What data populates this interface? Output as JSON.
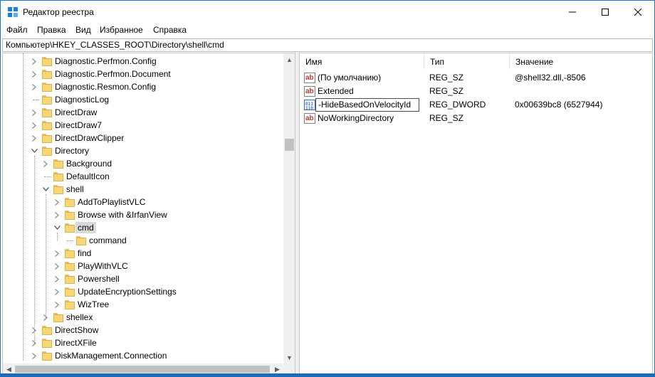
{
  "window": {
    "title": "Редактор реестра",
    "controls": {
      "minimize": "—",
      "maximize": "☐",
      "close": "✕"
    }
  },
  "menu": [
    "Файл",
    "Правка",
    "Вид",
    "Избранное",
    "Справка"
  ],
  "address": "Компьютер\\HKEY_CLASSES_ROOT\\Directory\\shell\\cmd",
  "tree": {
    "items": [
      {
        "label": "Diagnostic.Perfmon.Config",
        "level": 0,
        "expander": "closed"
      },
      {
        "label": "Diagnostic.Perfmon.Document",
        "level": 0,
        "expander": "closed"
      },
      {
        "label": "Diagnostic.Resmon.Config",
        "level": 0,
        "expander": "closed"
      },
      {
        "label": "DiagnosticLog",
        "level": 0,
        "expander": "none"
      },
      {
        "label": "DirectDraw",
        "level": 0,
        "expander": "closed"
      },
      {
        "label": "DirectDraw7",
        "level": 0,
        "expander": "closed"
      },
      {
        "label": "DirectDrawClipper",
        "level": 0,
        "expander": "closed"
      },
      {
        "label": "Directory",
        "level": 0,
        "expander": "open"
      },
      {
        "label": "Background",
        "level": 1,
        "expander": "closed"
      },
      {
        "label": "DefaultIcon",
        "level": 1,
        "expander": "none"
      },
      {
        "label": "shell",
        "level": 1,
        "expander": "open"
      },
      {
        "label": "AddToPlaylistVLC",
        "level": 2,
        "expander": "closed"
      },
      {
        "label": "Browse with &IrfanView",
        "level": 2,
        "expander": "closed"
      },
      {
        "label": "cmd",
        "level": 2,
        "expander": "open",
        "selected": true
      },
      {
        "label": "command",
        "level": 3,
        "expander": "none"
      },
      {
        "label": "find",
        "level": 2,
        "expander": "closed"
      },
      {
        "label": "PlayWithVLC",
        "level": 2,
        "expander": "closed"
      },
      {
        "label": "Powershell",
        "level": 2,
        "expander": "closed"
      },
      {
        "label": "UpdateEncryptionSettings",
        "level": 2,
        "expander": "closed"
      },
      {
        "label": "WizTree",
        "level": 2,
        "expander": "closed"
      },
      {
        "label": "shellex",
        "level": 1,
        "expander": "closed"
      },
      {
        "label": "DirectShow",
        "level": 0,
        "expander": "closed"
      },
      {
        "label": "DirectXFile",
        "level": 0,
        "expander": "closed"
      },
      {
        "label": "DiskManagement.Connection",
        "level": 0,
        "expander": "closed"
      }
    ]
  },
  "values": {
    "columns": {
      "name": "Имя",
      "type": "Тип",
      "data": "Значение"
    },
    "rows": [
      {
        "icon": "string-value-icon",
        "name": "(По умолчанию)",
        "type": "REG_SZ",
        "data": "@shell32.dll,-8506"
      },
      {
        "icon": "string-value-icon",
        "name": "Extended",
        "type": "REG_SZ",
        "data": ""
      },
      {
        "icon": "dword-value-icon",
        "name": "-HideBasedOnVelocityId",
        "type": "REG_DWORD",
        "data": "0x00639bc8 (6527944)",
        "editing": true
      },
      {
        "icon": "string-value-icon",
        "name": "NoWorkingDirectory",
        "type": "REG_SZ",
        "data": ""
      }
    ]
  },
  "icons": {
    "sz_glyph": "ab",
    "dword_glyph": "011\n110"
  },
  "colors": {
    "accent": "#1e73c9",
    "folder": "#f8d675",
    "selection": "#d9d9d9"
  }
}
